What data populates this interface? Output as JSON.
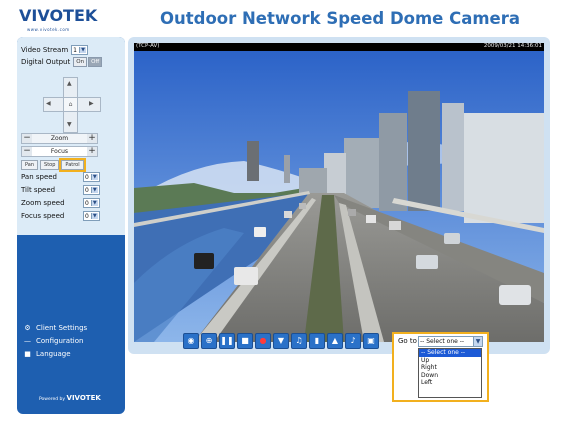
{
  "brand": {
    "logo": "VIVOTEK",
    "tagline": "www.vivotek.com"
  },
  "page_title": "Outdoor Network Speed Dome Camera",
  "sidebar": {
    "video_stream": {
      "label": "Video Stream",
      "value": "1"
    },
    "digital_output": {
      "label": "Digital Output",
      "on": "On",
      "off": "Off"
    },
    "zoom": {
      "minus": "−",
      "label": "Zoom",
      "plus": "+"
    },
    "focus": {
      "minus": "−",
      "label": "Focus",
      "plus": "+"
    },
    "buttons": {
      "pan": "Pan",
      "stop": "Stop",
      "patrol": "Patrol"
    },
    "speeds": [
      {
        "label": "Pan speed",
        "value": "0"
      },
      {
        "label": "Tilt speed",
        "value": "0"
      },
      {
        "label": "Zoom speed",
        "value": "0"
      },
      {
        "label": "Focus speed",
        "value": "0"
      }
    ],
    "links": [
      {
        "label": "Client Settings",
        "icon": "gear-icon"
      },
      {
        "label": "Configuration",
        "icon": "wrench-icon"
      },
      {
        "label": "Language",
        "icon": "speech-bubble-icon"
      }
    ],
    "powered_by": {
      "text": "Powered by",
      "brand": "VIVOTEK"
    }
  },
  "video": {
    "overlay_left": "(TCP-AV)",
    "overlay_right": "2009/03/21 14:36:01"
  },
  "toolbar": {
    "icons": [
      "camera-snapshot-icon",
      "digital-zoom-icon",
      "pause-icon",
      "stop-icon",
      "record-icon",
      "volume-icon",
      "speaker-icon",
      "talk-icon",
      "microphone-icon",
      "mic-mute-icon",
      "fullscreen-icon"
    ],
    "goto_label": "Go to",
    "goto_value": "-- Select one --",
    "goto_options": [
      "-- Select one --",
      "Up",
      "Right",
      "Down",
      "Left"
    ]
  },
  "colors": {
    "sidebar": "#1e5fb0",
    "highlight": "#f2b01e",
    "title": "#2e6eb5"
  }
}
